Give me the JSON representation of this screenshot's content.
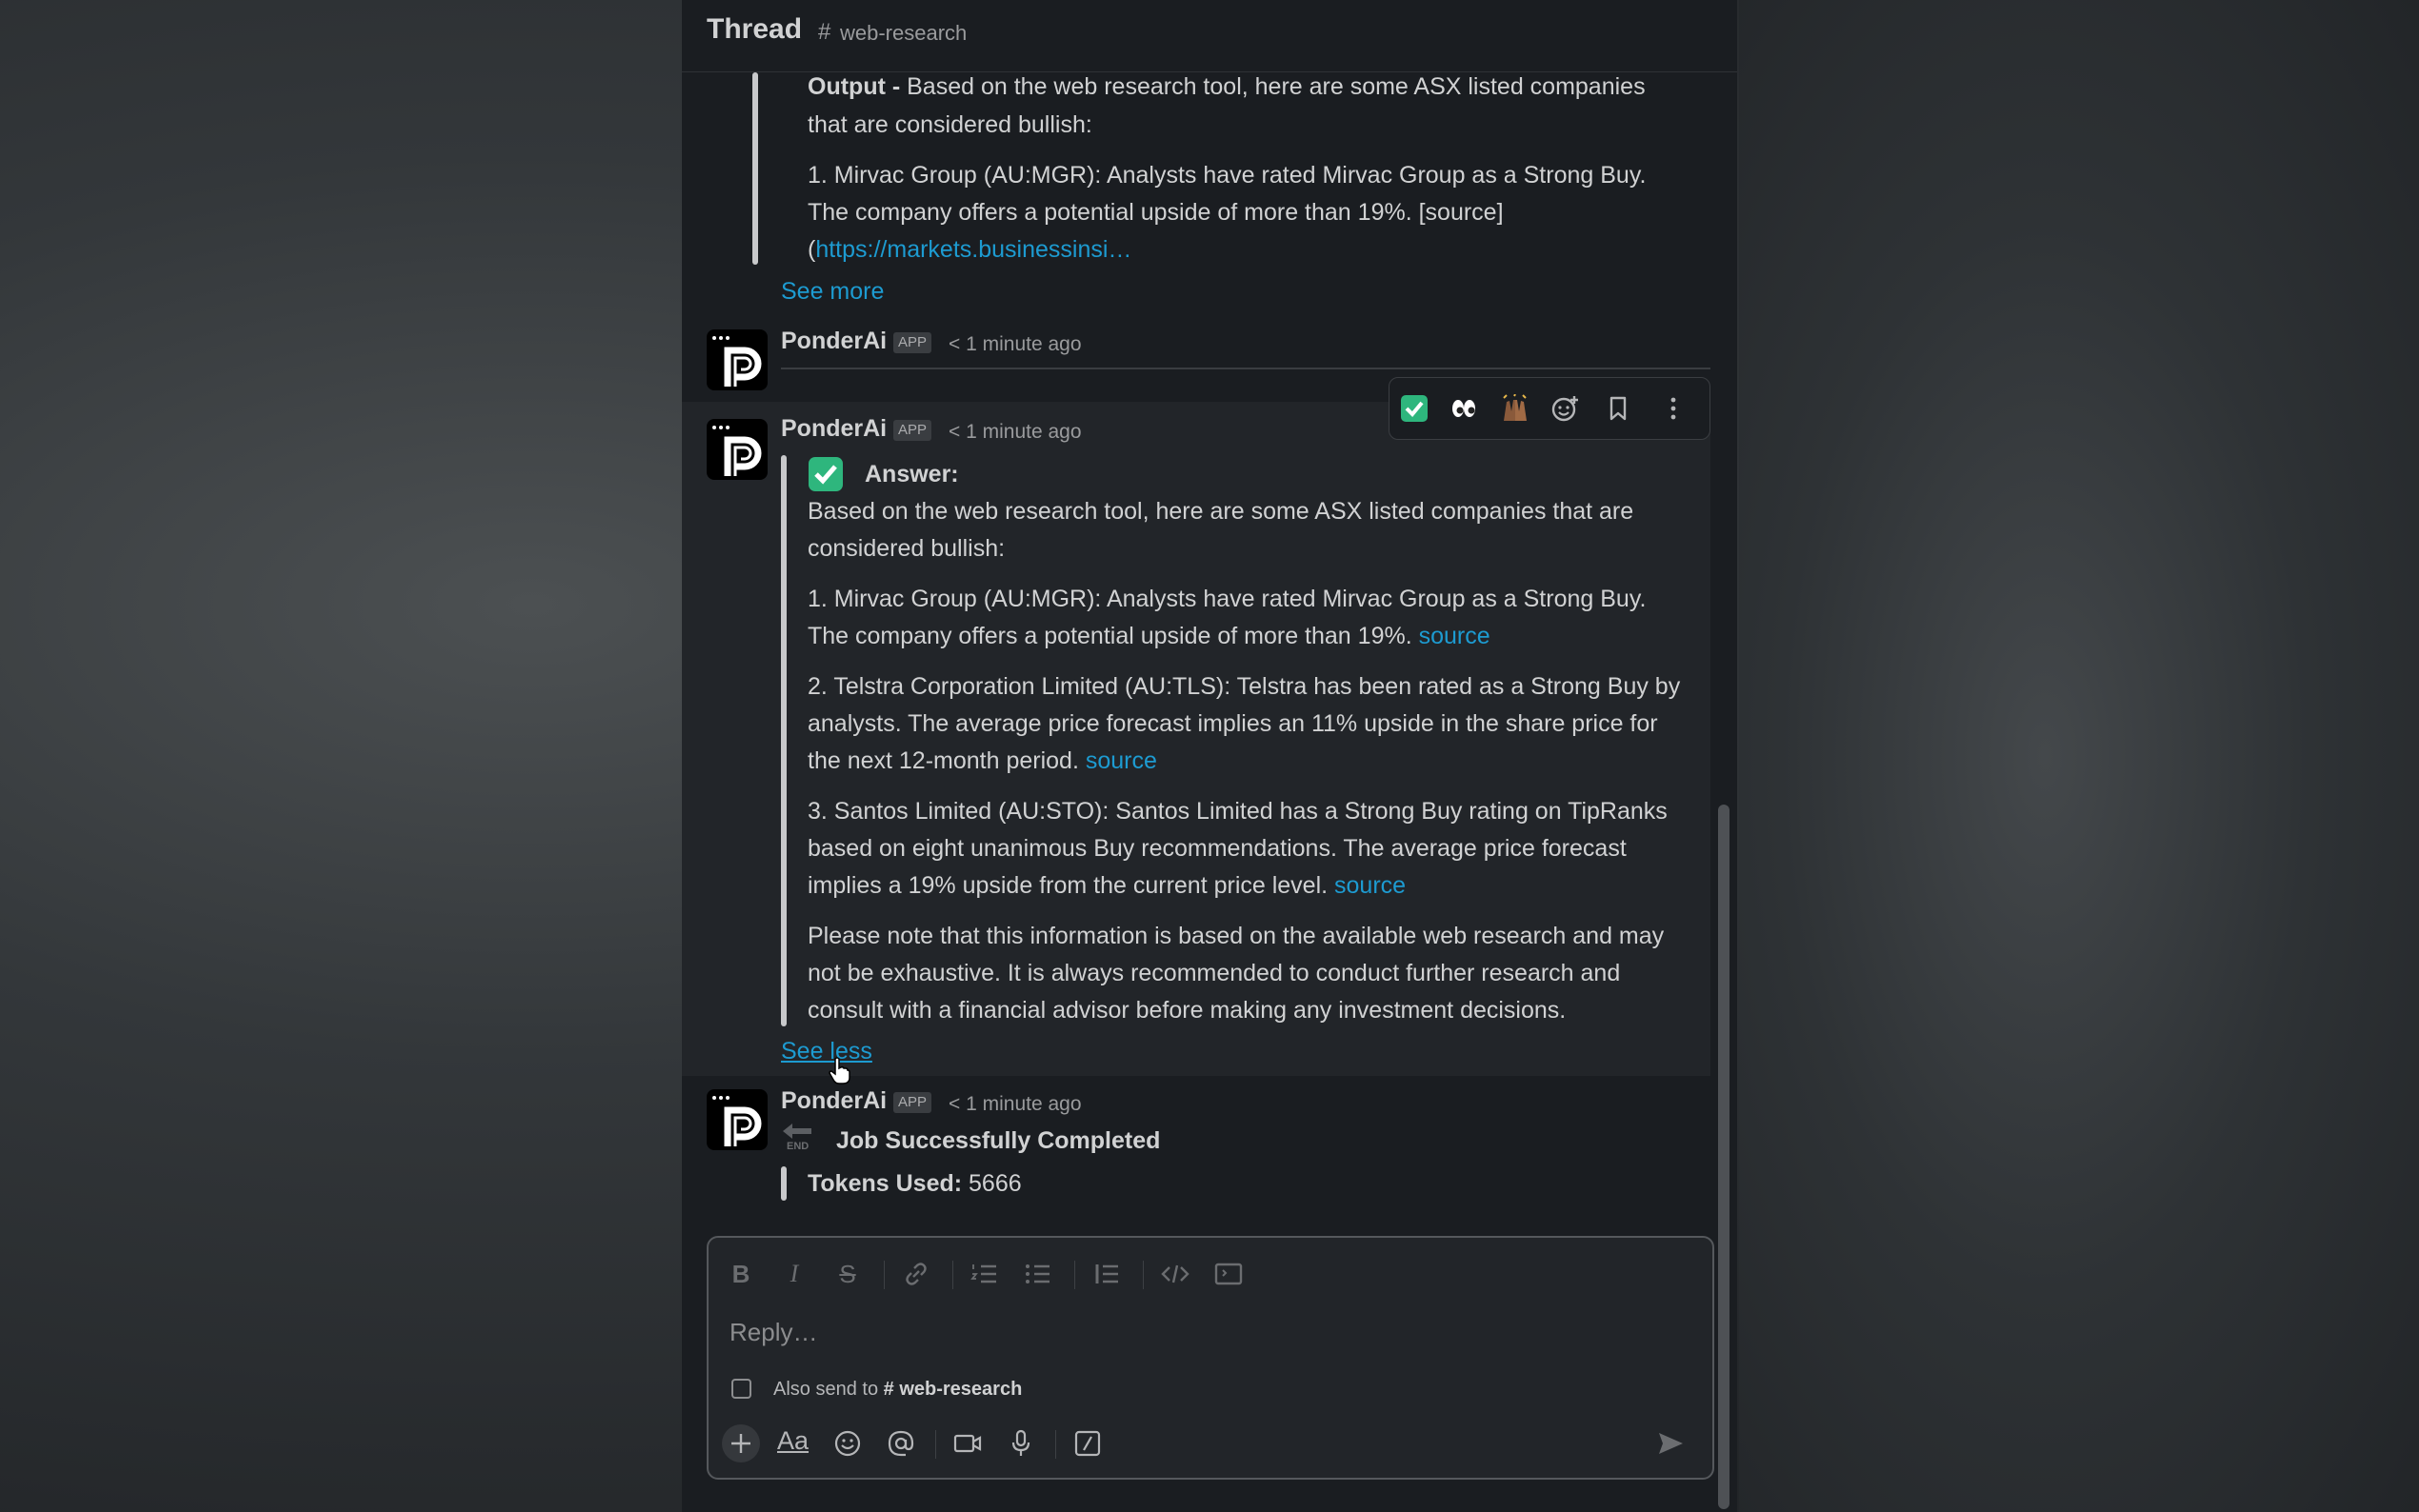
{
  "thread": {
    "title": "Thread",
    "channel_hash": "#",
    "channel": "web-research"
  },
  "earlier_message": {
    "output_label": "Output -",
    "output_line1": " Based on the web research tool, here are some ASX listed companies",
    "output_line2": "that are considered bullish:",
    "item1_line1": "1. Mirvac Group (AU:MGR): Analysts have rated Mirvac Group as a Strong Buy.",
    "item1_line2": "The company offers a potential upside of more than 19%. [source]",
    "item1_line3_prefix": "(",
    "item1_link": "https://markets.businessinsi…",
    "see_more": "See more"
  },
  "messages": [
    {
      "author": "PonderAi",
      "badge": "APP",
      "time": "< 1 minute ago"
    },
    {
      "author": "PonderAi",
      "badge": "APP",
      "time": "< 1 minute ago"
    },
    {
      "author": "PonderAi",
      "badge": "APP",
      "time": "< 1 minute ago"
    }
  ],
  "answer": {
    "heading": "Answer:",
    "intro_line1": "Based on the web research tool, here are some ASX listed companies that are",
    "intro_line2": "considered bullish:",
    "item1_line1": "1. Mirvac Group (AU:MGR): Analysts have rated Mirvac Group as a Strong Buy.",
    "item1_line2": "The company offers a potential upside of more than 19%. ",
    "item2_line1": "2. Telstra Corporation Limited (AU:TLS): Telstra has been rated as a Strong Buy by",
    "item2_line2": "analysts. The average price forecast implies an 11% upside in the share price for",
    "item2_line3": "the next 12-month period. ",
    "item3_line1": "3. Santos Limited (AU:STO): Santos Limited has a Strong Buy rating on TipRanks",
    "item3_line2": "based on eight unanimous Buy recommendations. The average price forecast",
    "item3_line3": "implies a 19% upside from the current price level. ",
    "source_link": "source",
    "note_line1": "Please note that this information is based on the available web research and may",
    "note_line2": "not be exhaustive. It is always recommended to conduct further research and",
    "note_line3": "consult with a financial advisor before making any investment decisions.",
    "see_less": "See less"
  },
  "job": {
    "end_label": "END",
    "status": "Job Successfully Completed",
    "tokens_label": "Tokens Used:",
    "tokens_value": " 5666"
  },
  "composer": {
    "placeholder": "Reply…",
    "also_send": "Also send to",
    "channel_hash": "#",
    "channel": "web-research",
    "format_label": "Aa"
  },
  "toolbar_icons": [
    "check-mark-reaction-icon",
    "eyes-reaction-icon",
    "raised-hands-reaction-icon",
    "add-reaction-icon",
    "bookmark-icon",
    "more-actions-icon"
  ],
  "colors": {
    "panel": "#1a1d21",
    "link": "#1d9bd1",
    "check_green": "#2eb67d"
  }
}
